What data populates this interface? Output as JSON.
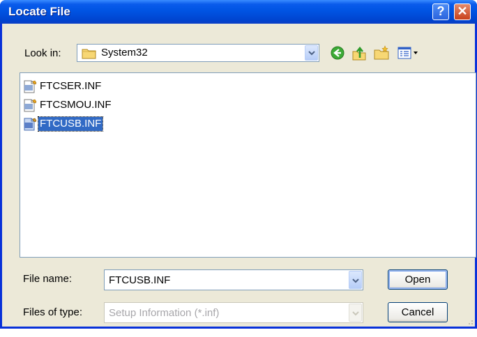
{
  "window": {
    "title": "Locate File",
    "help_glyph": "?",
    "close_glyph": "✕"
  },
  "lookin": {
    "label": "Look in:",
    "accesskey": "i",
    "value": "System32"
  },
  "files": [
    {
      "name": "FTCSER.INF",
      "selected": false
    },
    {
      "name": "FTCSMOU.INF",
      "selected": false
    },
    {
      "name": "FTCUSB.INF",
      "selected": true
    }
  ],
  "filename": {
    "label": "File name:",
    "accesskey": "n",
    "value": "FTCUSB.INF"
  },
  "filetype": {
    "label": "Files of type:",
    "accesskey": "t",
    "value": "Setup Information (*.inf)"
  },
  "buttons": {
    "open": "Open",
    "cancel": "Cancel"
  },
  "icons": [
    "help-icon",
    "close-icon",
    "folder-icon",
    "back-icon",
    "up-folder-icon",
    "new-folder-icon",
    "view-menu-icon",
    "inf-file-icon"
  ],
  "colors": {
    "titlebar": "#0054E3",
    "selection": "#316AC5",
    "dialog_bg": "#ECE9D8"
  }
}
